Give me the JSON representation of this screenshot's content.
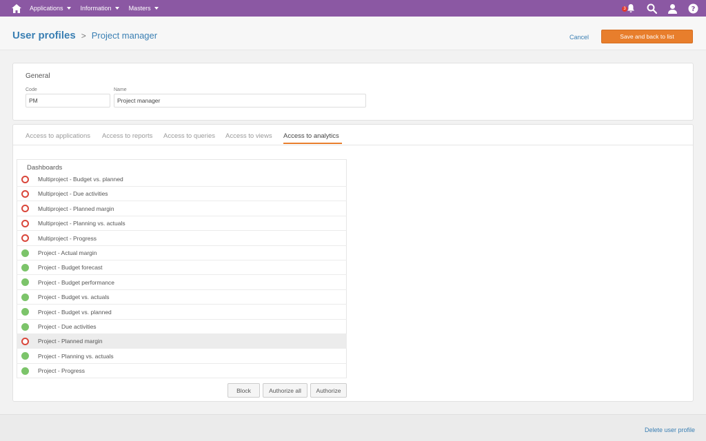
{
  "topbar": {
    "menus": [
      {
        "label": "Applications"
      },
      {
        "label": "Information"
      },
      {
        "label": "Masters"
      }
    ],
    "notification_count": "3",
    "icons": [
      "home-icon",
      "notification-icon",
      "search-icon",
      "user-icon",
      "help-icon"
    ],
    "colors": {
      "bar": "#8b58a3",
      "accent": "#e87e2c",
      "link": "#3a7fb3"
    }
  },
  "header": {
    "title": "User profiles",
    "separator": ">",
    "subtitle": "Project manager",
    "cancel_label": "Cancel",
    "save_label": "Save and back to list"
  },
  "general": {
    "title": "General",
    "code_label": "Code",
    "code_value": "PM",
    "name_label": "Name",
    "name_value": "Project manager"
  },
  "tabs": [
    {
      "label": "Access to applications",
      "active": false
    },
    {
      "label": "Access to reports",
      "active": false
    },
    {
      "label": "Access to queries",
      "active": false
    },
    {
      "label": "Access to views",
      "active": false
    },
    {
      "label": "Access to analytics",
      "active": true
    }
  ],
  "dashboards": {
    "title": "Dashboards",
    "items": [
      {
        "label": "Multiproject - Budget vs. planned",
        "status": "blocked"
      },
      {
        "label": "Multiproject - Due activities",
        "status": "blocked"
      },
      {
        "label": "Multiproject - Planned margin",
        "status": "blocked"
      },
      {
        "label": "Multiproject - Planning vs. actuals",
        "status": "blocked"
      },
      {
        "label": "Multiproject - Progress",
        "status": "blocked"
      },
      {
        "label": "Project - Actual margin",
        "status": "authorized"
      },
      {
        "label": "Project - Budget forecast",
        "status": "authorized"
      },
      {
        "label": "Project - Budget performance",
        "status": "authorized"
      },
      {
        "label": "Project - Budget vs. actuals",
        "status": "authorized"
      },
      {
        "label": "Project - Budget vs. planned",
        "status": "authorized"
      },
      {
        "label": "Project - Due activities",
        "status": "authorized"
      },
      {
        "label": "Project - Planned margin",
        "status": "blocked",
        "selected": true
      },
      {
        "label": "Project - Planning vs. actuals",
        "status": "authorized"
      },
      {
        "label": "Project - Progress",
        "status": "authorized"
      }
    ]
  },
  "actions": {
    "block_label": "Block",
    "authorize_all_label": "Authorize all",
    "authorize_label": "Authorize"
  },
  "footer": {
    "delete_label": "Delete user profile"
  }
}
